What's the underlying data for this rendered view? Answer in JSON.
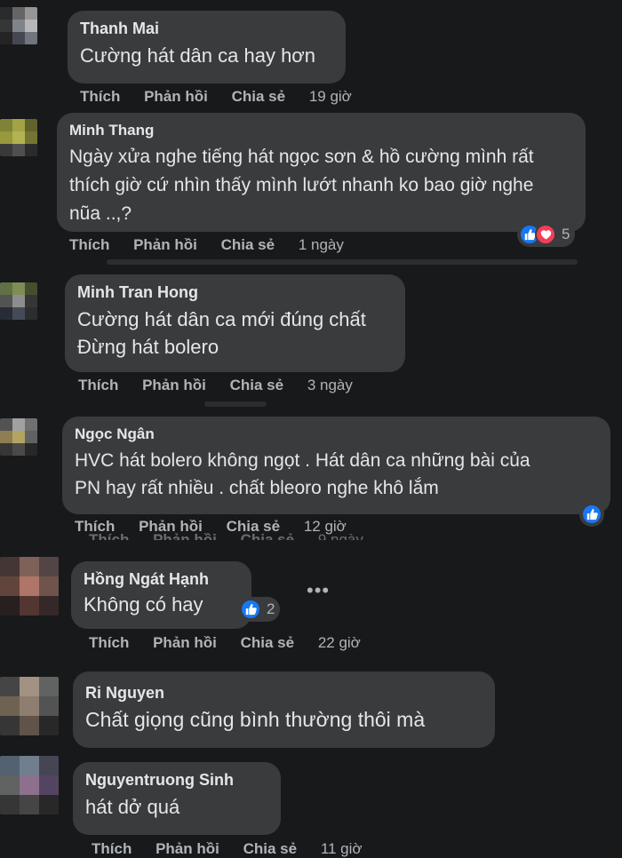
{
  "actions": {
    "like": "Thích",
    "reply": "Phản hồi",
    "share": "Chia sẻ"
  },
  "comments": [
    {
      "author": "Thanh Mai",
      "lines": [
        "Cường hát dân ca hay hơn"
      ],
      "time": "19 giờ"
    },
    {
      "author": "Minh Thang",
      "lines": [
        "Ngày xửa nghe tiếng hát ngọc sơn & hồ cường mình rất",
        "thích giờ cứ nhìn thấy mình lướt nhanh ko bao giờ nghe",
        "nũa ..,?"
      ],
      "time": "1 ngày",
      "reaction_count": "5"
    },
    {
      "author": "Minh Tran Hong",
      "lines": [
        "Cường hát dân ca mới đúng chất",
        "Đừng hát bolero"
      ],
      "time": "3 ngày"
    },
    {
      "author": "Ngọc Ngân",
      "lines": [
        "HVC hát bolero không ngọt . Hát dân ca những bài của",
        "PN hay rất nhiều . chất bleoro nghe khô lắm"
      ],
      "time": "12 giờ"
    },
    {
      "author": "Hồng Ngát Hạnh",
      "lines": [
        "Không có hay"
      ],
      "time": "22 giờ",
      "reaction_count": "2"
    },
    {
      "author": "Ri Nguyen",
      "lines": [
        "Chất giọng cũng bình thường thôi mà"
      ]
    },
    {
      "author": "Nguyentruong Sinh",
      "lines": [
        "hát dở quá"
      ],
      "time": "11 giờ"
    }
  ],
  "ghost_rows": [
    {
      "time": "9 ngày"
    }
  ],
  "icons": {
    "like": "thumbs-up-icon",
    "love": "heart-icon",
    "more": "more-options-icon"
  },
  "colors": {
    "background": "#18191a",
    "bubble": "#3a3b3c",
    "like": "#1877f2",
    "love": "#f33e58"
  }
}
